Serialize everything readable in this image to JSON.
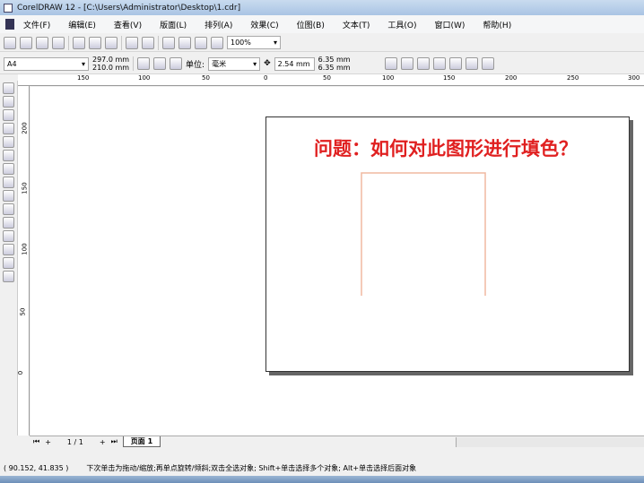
{
  "window": {
    "title": "CorelDRAW 12 - [C:\\Users\\Administrator\\Desktop\\1.cdr]"
  },
  "menu": [
    "文件(F)",
    "编辑(E)",
    "查看(V)",
    "版面(L)",
    "排列(A)",
    "效果(C)",
    "位图(B)",
    "文本(T)",
    "工具(O)",
    "窗口(W)",
    "帮助(H)"
  ],
  "toolbar": {
    "zoom": "100%"
  },
  "property_bar": {
    "paper": "A4",
    "height": "297.0 mm",
    "width": "210.0 mm",
    "unit_label": "单位:",
    "unit": "毫米",
    "nudge": "2.54 mm",
    "dup_x": "6.35 mm",
    "dup_y": "6.35 mm"
  },
  "ruler_top": [
    "150",
    "100",
    "50",
    "0",
    "50",
    "100",
    "150",
    "200",
    "250",
    "300"
  ],
  "ruler_left": [
    "200",
    "150",
    "100",
    "50",
    "0"
  ],
  "canvas": {
    "question": "问题：如何对此图形进行填色？",
    "shape_color": "#f0b8a0",
    "question_color": "#e02020"
  },
  "pagebar": {
    "count": "1 / 1",
    "tab": "页面 1"
  },
  "status": {
    "coords": "( 90.152, 41.835 )",
    "hint": "下次单击为拖动/缩放;再单点旋转/倾斜;双击全选对象; Shift+单击选择多个对象; Alt+单击选择后面对象"
  }
}
